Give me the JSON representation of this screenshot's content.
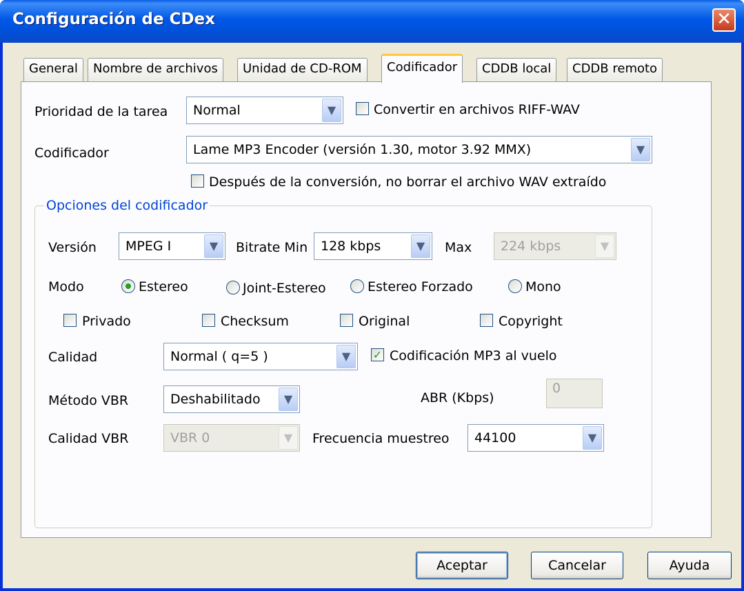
{
  "window": {
    "title": "Configuración de CDex",
    "close_glyph": "✕"
  },
  "tabs": [
    {
      "label": "General"
    },
    {
      "label": "Nombre de archivos"
    },
    {
      "label": "Unidad de CD-ROM"
    },
    {
      "label": "Codificador",
      "active": true
    },
    {
      "label": "CDDB local"
    },
    {
      "label": "CDDB remoto"
    }
  ],
  "priority": {
    "label": "Prioridad de la tarea",
    "value": "Normal"
  },
  "riff_wav": {
    "label": "Convertir en archivos RIFF-WAV",
    "checked": false
  },
  "encoder": {
    "label": "Codificador",
    "value": "Lame MP3 Encoder (versión 1.30, motor 3.92 MMX)"
  },
  "keep_wav": {
    "label": "Después de la conversión, no borrar el archivo WAV extraído",
    "checked": false
  },
  "options": {
    "title": "Opciones del codificador",
    "version": {
      "label": "Versión",
      "value": "MPEG I"
    },
    "bitrate_min": {
      "label": "Bitrate Min",
      "value": "128 kbps"
    },
    "bitrate_max": {
      "label": "Max",
      "value": "224 kbps"
    },
    "mode": {
      "label": "Modo",
      "options": [
        "Estereo",
        "Joint-Estereo",
        "Estereo Forzado",
        "Mono"
      ],
      "selected": "Estereo"
    },
    "flags": {
      "private": "Privado",
      "checksum": "Checksum",
      "original": "Original",
      "copyright": "Copyright"
    },
    "quality": {
      "label": "Calidad",
      "value": "Normal ( q=5 )"
    },
    "on_the_fly": {
      "label": "Codificación MP3 al vuelo",
      "checked": true
    },
    "vbr_method": {
      "label": "Método VBR",
      "value": "Deshabilitado"
    },
    "abr": {
      "label": "ABR (Kbps)",
      "value": "0"
    },
    "vbr_quality": {
      "label": "Calidad VBR",
      "value": "VBR 0"
    },
    "sample_rate": {
      "label": "Frecuencia muestreo",
      "value": "44100"
    }
  },
  "buttons": {
    "ok": "Aceptar",
    "cancel": "Cancelar",
    "help": "Ayuda"
  },
  "icons": {
    "dropdown": "chevron-down-icon",
    "check": "✓"
  }
}
